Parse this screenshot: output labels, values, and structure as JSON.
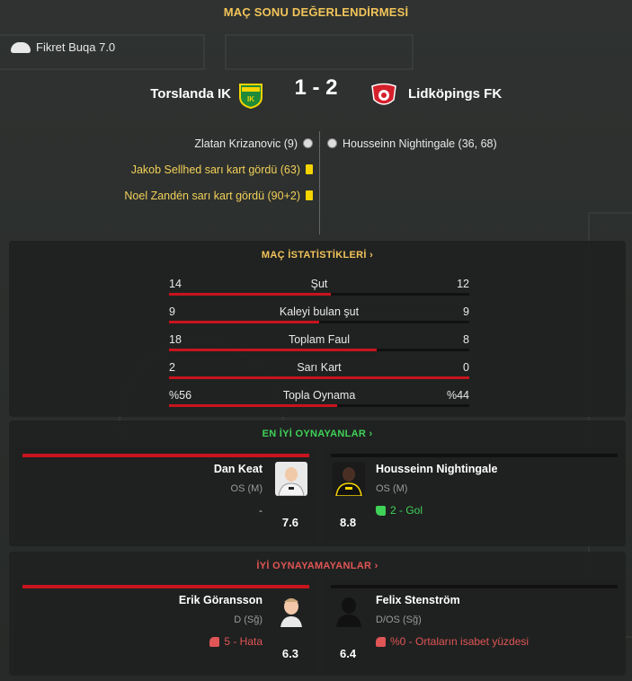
{
  "header": {
    "title": "MAÇ SONU DEĞERLENDİRMESİ"
  },
  "motm": {
    "icon": "boot-icon",
    "text": "Fikret Buqa 7.0"
  },
  "match": {
    "home_team": "Torslanda IK",
    "away_team": "Lidköpings FK",
    "score": "1 - 2",
    "home_events": [
      {
        "text": "Zlatan Krizanovic (9)",
        "type": "goal"
      },
      {
        "text": "Jakob Sellhed sarı kart gördü (63)",
        "type": "yellow"
      },
      {
        "text": "Noel Zandén sarı kart gördü (90+2)",
        "type": "yellow"
      }
    ],
    "away_events": [
      {
        "text": "Housseinn Nightingale (36, 68)",
        "type": "goal"
      }
    ]
  },
  "stats": {
    "title": "MAÇ İSTATİSTİKLERİ ›",
    "rows": [
      {
        "label": "Şut",
        "home": "14",
        "away": "12",
        "home_share": 0.538
      },
      {
        "label": "Kaleyi bulan şut",
        "home": "9",
        "away": "9",
        "home_share": 0.5
      },
      {
        "label": "Toplam Faul",
        "home": "18",
        "away": "8",
        "home_share": 0.692
      },
      {
        "label": "Sarı Kart",
        "home": "2",
        "away": "0",
        "home_share": 1.0
      },
      {
        "label": "Topla Oynama",
        "home": "%56",
        "away": "%44",
        "home_share": 0.56
      }
    ]
  },
  "best": {
    "title": "EN İYİ OYNAYANLAR ›",
    "home": {
      "name": "Dan Keat",
      "position": "OS (M)",
      "rating": "7.6",
      "note": "-"
    },
    "away": {
      "name": "Housseinn Nightingale",
      "position": "OS (M)",
      "rating": "8.8",
      "note": "2 - Gol"
    }
  },
  "worst": {
    "title": "İYİ OYNAYAMAYANLAR ›",
    "home": {
      "name": "Erik Göransson",
      "position": "D (Sğ)",
      "rating": "6.3",
      "note": "5 - Hata"
    },
    "away": {
      "name": "Felix Stenström",
      "position": "D/OS (Sğ)",
      "rating": "6.4",
      "note": "%0 - Ortaların isabet yüzdesi"
    }
  },
  "colors": {
    "accent_gold": "#f2c45a",
    "green": "#3fd158",
    "red": "#c8141e",
    "warn_red": "#e05555"
  }
}
